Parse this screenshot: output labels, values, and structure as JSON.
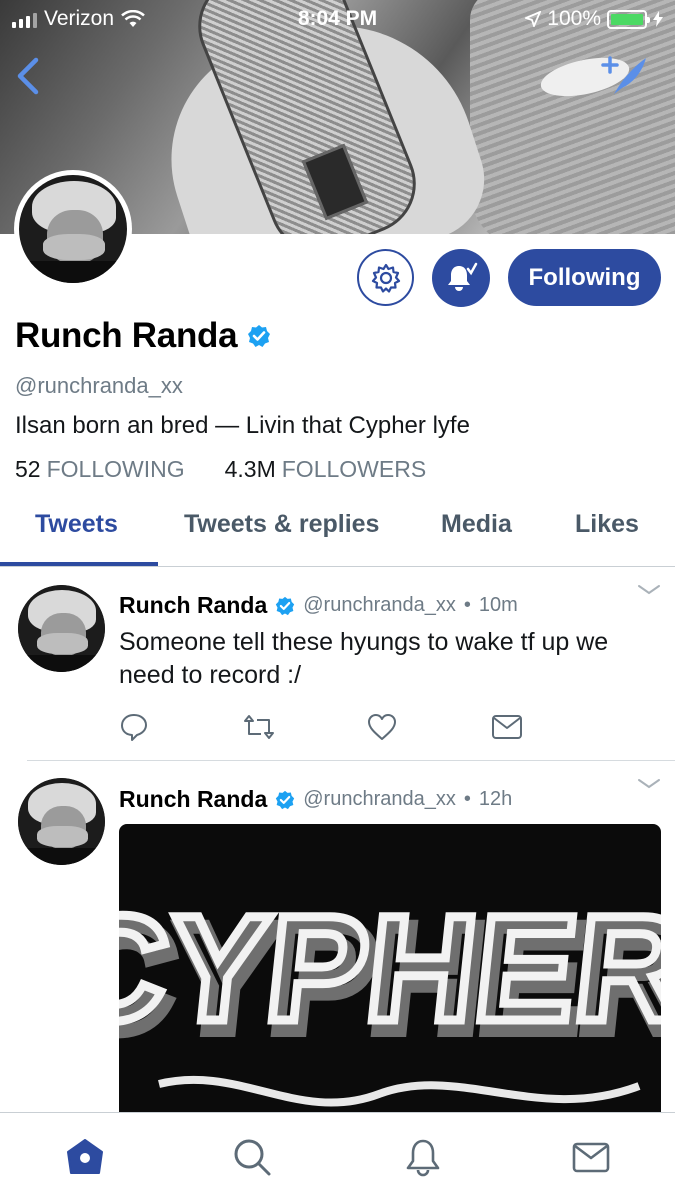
{
  "status_bar": {
    "carrier": "Verizon",
    "time": "8:04 PM",
    "battery": "100%"
  },
  "header": {
    "back_icon": "chevron-left-icon",
    "compose_icon": "compose-feather-icon"
  },
  "profile": {
    "name": "Runch Randa",
    "verified_icon": "verified-badge-icon",
    "handle": "@runchranda_xx",
    "bio": "Ilsan born an bred — Livin that Cypher lyfe",
    "following_count": "52",
    "following_label": "FOLLOWING",
    "followers_count": "4.3M",
    "followers_label": "FOLLOWERS",
    "follow_button_label": "Following"
  },
  "tabs": [
    {
      "label": "Tweets",
      "active": true
    },
    {
      "label": "Tweets & replies",
      "active": false
    },
    {
      "label": "Media",
      "active": false
    },
    {
      "label": "Likes",
      "active": false
    }
  ],
  "tweets": [
    {
      "name": "Runch Randa",
      "handle": "@runchranda_xx",
      "separator": "•",
      "time": "10m",
      "text": "Someone tell these hyungs to wake tf up we need to record :/"
    },
    {
      "name": "Runch Randa",
      "handle": "@runchranda_xx",
      "separator": "•",
      "time": "12h",
      "media_text": "CYPHER"
    }
  ],
  "tabbar": [
    "home-icon",
    "search-icon",
    "notifications-bell-icon",
    "messages-envelope-icon"
  ],
  "colors": {
    "accent": "#2d4ba0",
    "verified": "#1da1f2",
    "secondary_text": "#6e7b86"
  }
}
